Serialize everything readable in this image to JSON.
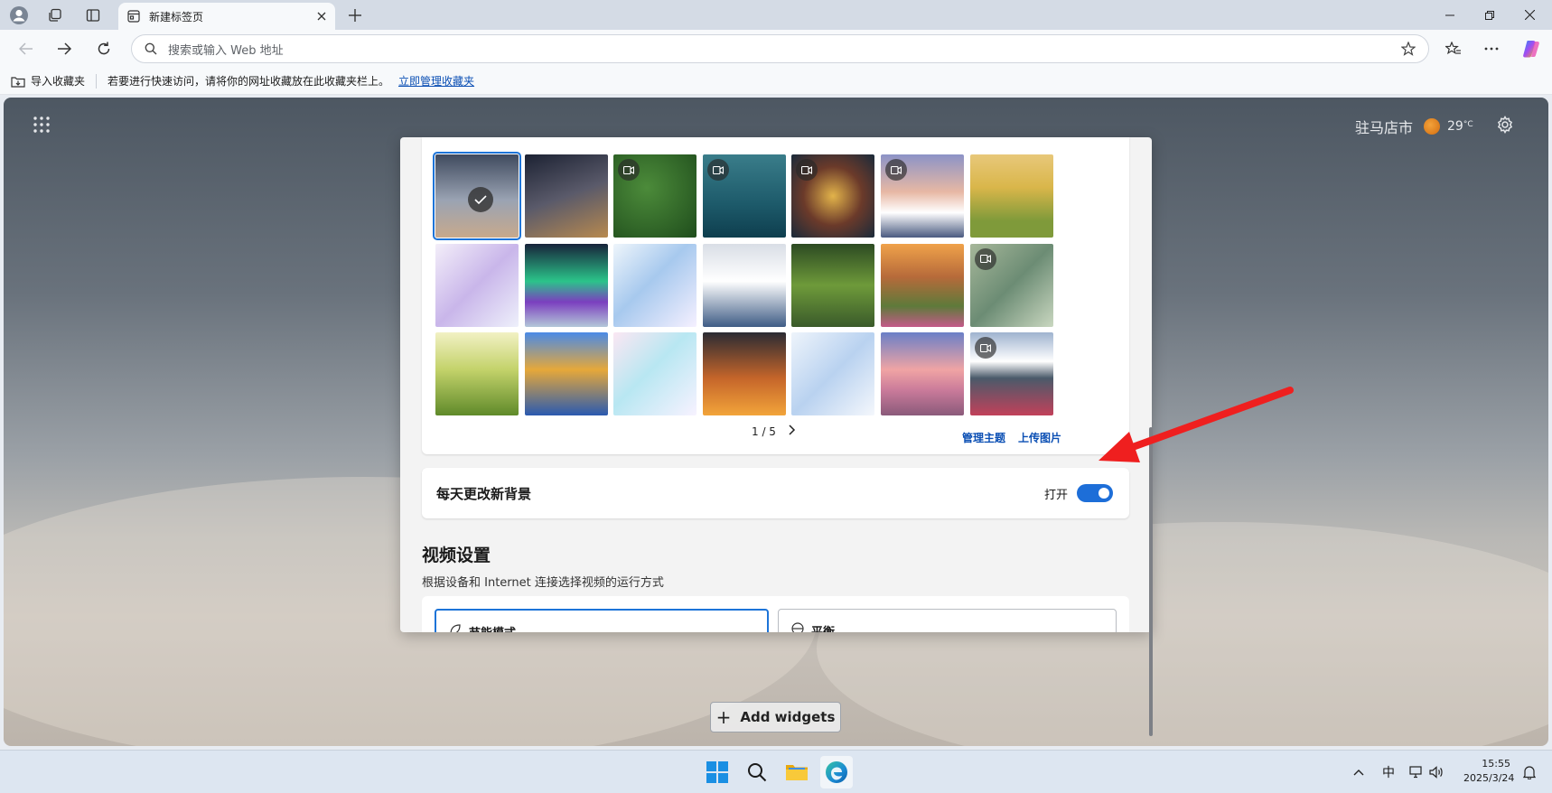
{
  "browser": {
    "tab_title": "新建标签页",
    "address_placeholder": "搜索或输入 Web 地址"
  },
  "favorites_bar": {
    "import_label": "导入收藏夹",
    "hint": "若要进行快速访问，请将你的网址收藏放在此收藏夹栏上。",
    "manage_link": "立即管理收藏夹"
  },
  "weather": {
    "city": "驻马店市",
    "temperature": "29",
    "unit": "°C"
  },
  "background_gallery": {
    "thumbnails": [
      {
        "id": "t1",
        "video": false,
        "selected": true
      },
      {
        "id": "t2",
        "video": false
      },
      {
        "id": "t3",
        "video": true
      },
      {
        "id": "t4",
        "video": true
      },
      {
        "id": "t5",
        "video": true
      },
      {
        "id": "t6",
        "video": true
      },
      {
        "id": "t7",
        "video": false
      },
      {
        "id": "t8",
        "video": false
      },
      {
        "id": "t9",
        "video": false
      },
      {
        "id": "t10",
        "video": false
      },
      {
        "id": "t11",
        "video": false
      },
      {
        "id": "t12",
        "video": false
      },
      {
        "id": "t13",
        "video": false
      },
      {
        "id": "t14",
        "video": true
      },
      {
        "id": "t15",
        "video": false
      },
      {
        "id": "t16",
        "video": false
      },
      {
        "id": "t17",
        "video": false
      },
      {
        "id": "t18",
        "video": false
      },
      {
        "id": "t19",
        "video": false
      },
      {
        "id": "t20",
        "video": false
      },
      {
        "id": "t21",
        "video": true
      }
    ],
    "page_indicator": "1 / 5",
    "manage_themes": "管理主题",
    "upload_image": "上传图片"
  },
  "daily_background": {
    "label": "每天更改新背景",
    "state_label": "打开",
    "enabled": true
  },
  "video_settings": {
    "title": "视频设置",
    "description": "根据设备和 Internet 连接选择视频的运行方式",
    "option_eco": "节能模式",
    "option_balanced": "平衡"
  },
  "add_widgets_label": "Add widgets",
  "taskbar": {
    "ime": "中",
    "time": "15:55",
    "date": "2025/3/24"
  },
  "colors": {
    "accent": "#1d74d8",
    "link": "#0b4fb4"
  }
}
